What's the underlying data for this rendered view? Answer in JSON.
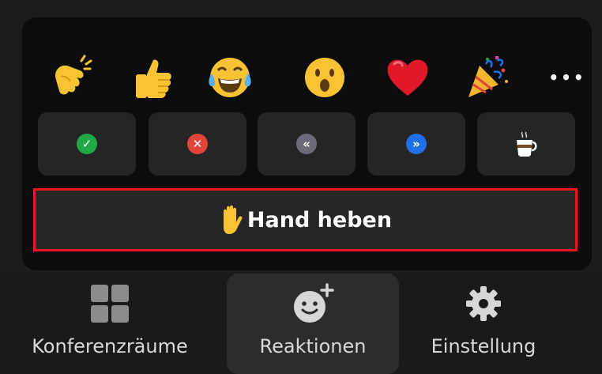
{
  "reactions_popup": {
    "emojis": [
      {
        "name": "clapping-hands",
        "glyph": "👏"
      },
      {
        "name": "thumbs-up",
        "glyph": "👍"
      },
      {
        "name": "tears-of-joy",
        "glyph": "😂"
      },
      {
        "name": "open-mouth",
        "glyph": "😮"
      },
      {
        "name": "red-heart",
        "glyph": "❤"
      },
      {
        "name": "party-popper",
        "glyph": "🎉"
      }
    ],
    "more_label": "•••",
    "quick_actions": [
      {
        "name": "yes",
        "symbol": "✓",
        "color": "#1faa45"
      },
      {
        "name": "no",
        "symbol": "✕",
        "color": "#e0443a"
      },
      {
        "name": "slow-down",
        "symbol": "«",
        "color": "#6b6b7a"
      },
      {
        "name": "speed-up",
        "symbol": "»",
        "color": "#1f6fe8"
      },
      {
        "name": "coffee-break",
        "symbol": "☕",
        "color": "#ffffff"
      }
    ],
    "raise_hand": {
      "emoji": "✋",
      "label": "Hand heben"
    }
  },
  "bottom_bar": {
    "items": [
      {
        "label": "Konferenzräume",
        "icon": "grid-icon"
      },
      {
        "label": "Reaktionen",
        "icon": "add-reaction-icon",
        "active": true
      },
      {
        "label": "Einstellung",
        "icon": "gear-icon"
      }
    ]
  },
  "colors": {
    "highlight_border": "#e8161d",
    "button_bg": "#252525",
    "popup_bg": "#0c0c0c"
  }
}
